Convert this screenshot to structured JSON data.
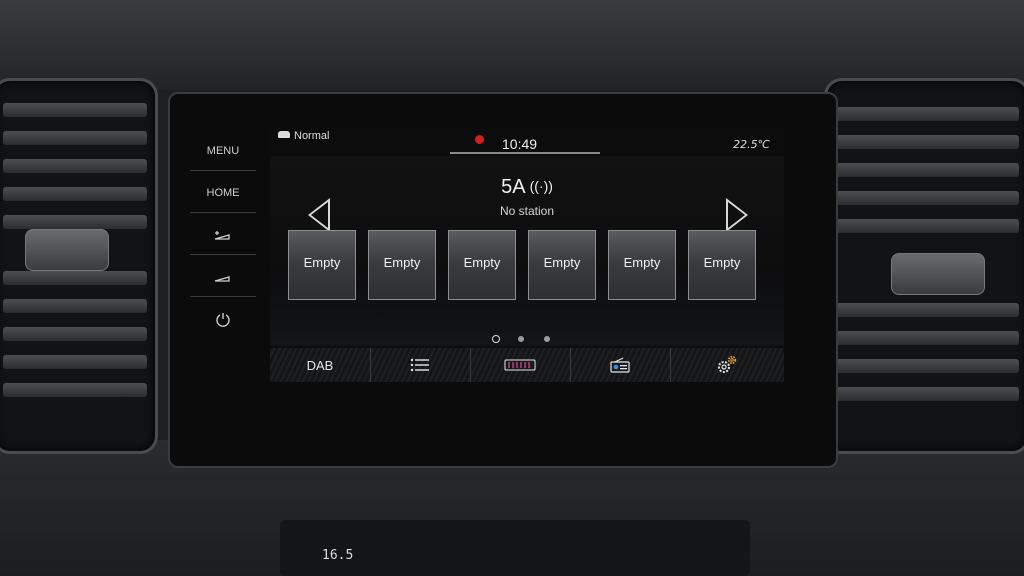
{
  "hardware_buttons": [
    "MENU",
    "HOME"
  ],
  "status_bar": {
    "drive_mode": "Normal",
    "time": "10:49",
    "outside_temperature": "22.5℃"
  },
  "station": {
    "channel": "5A",
    "signal_icon": "broadcast-signal-icon",
    "status": "No station"
  },
  "presets": [
    {
      "label": "Empty"
    },
    {
      "label": "Empty"
    },
    {
      "label": "Empty"
    },
    {
      "label": "Empty"
    },
    {
      "label": "Empty"
    },
    {
      "label": "Empty"
    }
  ],
  "page_indicator": {
    "pages": 3,
    "active": 1
  },
  "tabs": [
    {
      "label": "DAB",
      "icon": ""
    },
    {
      "label": "",
      "icon": "list-icon"
    },
    {
      "label": "",
      "icon": "frequency-band-icon"
    },
    {
      "label": "",
      "icon": "radio-source-icon"
    },
    {
      "label": "",
      "icon": "settings-gears-icon"
    }
  ],
  "climate": {
    "temperature": "16.5"
  },
  "colors": {
    "alert": "#d3201c",
    "screen_bg": "#0c0c0d",
    "preset_border": "#8f8f92"
  }
}
